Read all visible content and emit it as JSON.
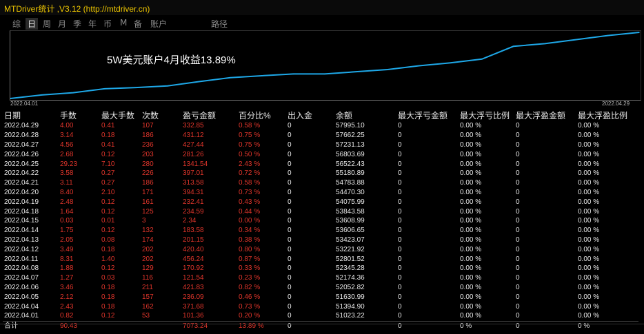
{
  "title": "MTDriver统计 ,V3.12 (http://mtdriver.cn)",
  "toolbar": {
    "tabs": [
      "综",
      "日",
      "周",
      "月",
      "季",
      "年",
      "币",
      "M",
      "备",
      "账户"
    ],
    "active": "日",
    "path_label": "路径"
  },
  "chart_label": "5W美元账户4月收益13.89%",
  "chart_data": {
    "type": "line",
    "x_start_label": "2022.04.01",
    "x_end_label": "2022.04.29",
    "x": [
      "2022.04.01",
      "2022.04.04",
      "2022.04.05",
      "2022.04.06",
      "2022.04.07",
      "2022.04.08",
      "2022.04.11",
      "2022.04.12",
      "2022.04.13",
      "2022.04.14",
      "2022.04.15",
      "2022.04.18",
      "2022.04.19",
      "2022.04.20",
      "2022.04.21",
      "2022.04.22",
      "2022.04.25",
      "2022.04.26",
      "2022.04.27",
      "2022.04.28",
      "2022.04.29"
    ],
    "series": [
      {
        "values": [
          51023.22,
          51394.9,
          51630.99,
          52052.82,
          52174.36,
          52345.28,
          52801.52,
          53221.92,
          53423.07,
          53606.65,
          53608.99,
          53843.58,
          54075.99,
          54470.3,
          54783.88,
          55180.89,
          56522.43,
          56803.69,
          57231.13,
          57662.25,
          57995.1
        ]
      }
    ],
    "color": "#1ea8e8",
    "grid": false
  },
  "table": {
    "headers": [
      "日期",
      "手数",
      "最大手数",
      "次数",
      "盈亏金额",
      "百分比%",
      "出入金",
      "余额",
      "最大浮亏金额",
      "最大浮亏比例",
      "最大浮盈金额",
      "最大浮盈比例"
    ],
    "rows": [
      [
        "2022.04.29",
        "4.00",
        "0.41",
        "107",
        "332.85",
        "0.58 %",
        "0",
        "57995.10",
        "0",
        "0.00 %",
        "0",
        "0.00 %"
      ],
      [
        "2022.04.28",
        "3.14",
        "0.18",
        "186",
        "431.12",
        "0.75 %",
        "0",
        "57662.25",
        "0",
        "0.00 %",
        "0",
        "0.00 %"
      ],
      [
        "2022.04.27",
        "4.56",
        "0.41",
        "236",
        "427.44",
        "0.75 %",
        "0",
        "57231.13",
        "0",
        "0.00 %",
        "0",
        "0.00 %"
      ],
      [
        "2022.04.26",
        "2.68",
        "0.12",
        "203",
        "281.26",
        "0.50 %",
        "0",
        "56803.69",
        "0",
        "0.00 %",
        "0",
        "0.00 %"
      ],
      [
        "2022.04.25",
        "29.23",
        "7.10",
        "280",
        "1341.54",
        "2.43 %",
        "0",
        "56522.43",
        "0",
        "0.00 %",
        "0",
        "0.00 %"
      ],
      [
        "2022.04.22",
        "3.58",
        "0.27",
        "226",
        "397.01",
        "0.72 %",
        "0",
        "55180.89",
        "0",
        "0.00 %",
        "0",
        "0.00 %"
      ],
      [
        "2022.04.21",
        "3.11",
        "0.27",
        "186",
        "313.58",
        "0.58 %",
        "0",
        "54783.88",
        "0",
        "0.00 %",
        "0",
        "0.00 %"
      ],
      [
        "2022.04.20",
        "8.40",
        "2.10",
        "171",
        "394.31",
        "0.73 %",
        "0",
        "54470.30",
        "0",
        "0.00 %",
        "0",
        "0.00 %"
      ],
      [
        "2022.04.19",
        "2.48",
        "0.12",
        "161",
        "232.41",
        "0.43 %",
        "0",
        "54075.99",
        "0",
        "0.00 %",
        "0",
        "0.00 %"
      ],
      [
        "2022.04.18",
        "1.64",
        "0.12",
        "125",
        "234.59",
        "0.44 %",
        "0",
        "53843.58",
        "0",
        "0.00 %",
        "0",
        "0.00 %"
      ],
      [
        "2022.04.15",
        "0.03",
        "0.01",
        "3",
        "2.34",
        "0.00 %",
        "0",
        "53608.99",
        "0",
        "0.00 %",
        "0",
        "0.00 %"
      ],
      [
        "2022.04.14",
        "1.75",
        "0.12",
        "132",
        "183.58",
        "0.34 %",
        "0",
        "53606.65",
        "0",
        "0.00 %",
        "0",
        "0.00 %"
      ],
      [
        "2022.04.13",
        "2.05",
        "0.08",
        "174",
        "201.15",
        "0.38 %",
        "0",
        "53423.07",
        "0",
        "0.00 %",
        "0",
        "0.00 %"
      ],
      [
        "2022.04.12",
        "3.49",
        "0.18",
        "202",
        "420.40",
        "0.80 %",
        "0",
        "53221.92",
        "0",
        "0.00 %",
        "0",
        "0.00 %"
      ],
      [
        "2022.04.11",
        "8.31",
        "1.40",
        "202",
        "456.24",
        "0.87 %",
        "0",
        "52801.52",
        "0",
        "0.00 %",
        "0",
        "0.00 %"
      ],
      [
        "2022.04.08",
        "1.88",
        "0.12",
        "129",
        "170.92",
        "0.33 %",
        "0",
        "52345.28",
        "0",
        "0.00 %",
        "0",
        "0.00 %"
      ],
      [
        "2022.04.07",
        "1.27",
        "0.03",
        "116",
        "121.54",
        "0.23 %",
        "0",
        "52174.36",
        "0",
        "0.00 %",
        "0",
        "0.00 %"
      ],
      [
        "2022.04.06",
        "3.46",
        "0.18",
        "211",
        "421.83",
        "0.82 %",
        "0",
        "52052.82",
        "0",
        "0.00 %",
        "0",
        "0.00 %"
      ],
      [
        "2022.04.05",
        "2.12",
        "0.18",
        "157",
        "236.09",
        "0.46 %",
        "0",
        "51630.99",
        "0",
        "0.00 %",
        "0",
        "0.00 %"
      ],
      [
        "2022.04.04",
        "2.43",
        "0.18",
        "162",
        "371.68",
        "0.73 %",
        "0",
        "51394.90",
        "0",
        "0.00 %",
        "0",
        "0.00 %"
      ],
      [
        "2022.04.01",
        "0.82",
        "0.12",
        "53",
        "101.36",
        "0.20 %",
        "0",
        "51023.22",
        "0",
        "0.00 %",
        "0",
        "0.00 %"
      ]
    ],
    "total": [
      "合计",
      "90.43",
      "",
      "",
      "7073.24",
      "13.89 %",
      "0",
      "",
      "0",
      "0 %",
      "0",
      "0 %"
    ],
    "red_columns": [
      1,
      2,
      3,
      4,
      5
    ],
    "red_color": "#e0352b"
  }
}
